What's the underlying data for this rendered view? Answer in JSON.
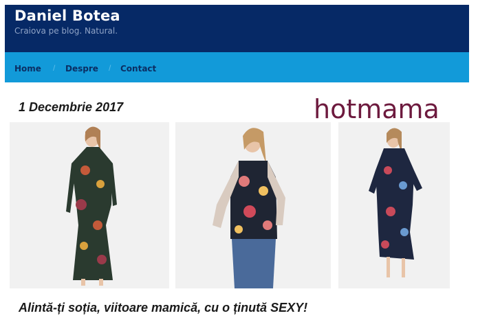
{
  "header": {
    "site_title": "Daniel Botea",
    "tagline": "Craiova pe blog. Natural."
  },
  "nav": {
    "items": [
      {
        "label": "Home"
      },
      {
        "label": "Despre"
      },
      {
        "label": "Contact"
      }
    ],
    "separator": "/"
  },
  "post": {
    "date": "1 Decembrie 2017",
    "brand_logo": "hotmama",
    "title": "Alintă-ți soția, viitoare mamică, cu o ținută SEXY!"
  },
  "colors": {
    "header_bg": "#062966",
    "nav_bg": "#129ad9",
    "brand": "#6d1a3e"
  }
}
